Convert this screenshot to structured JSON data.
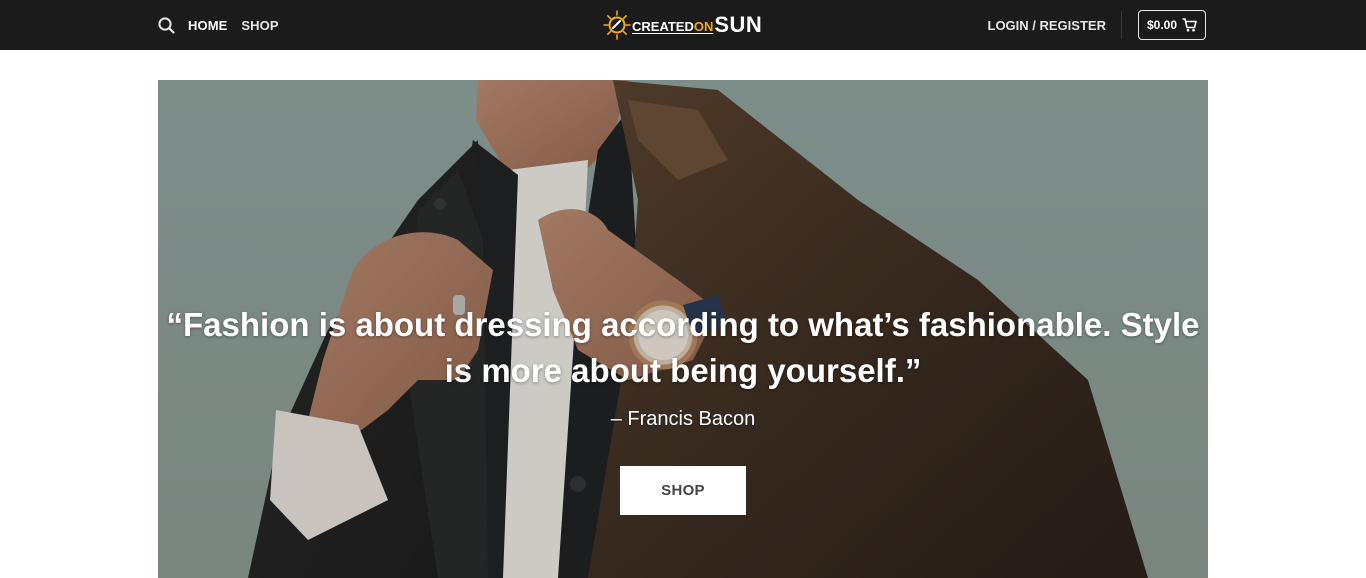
{
  "header": {
    "nav": {
      "search_icon": "search-icon",
      "home_label": "HOME",
      "shop_label": "SHOP"
    },
    "logo": {
      "text_created": "CREATED",
      "text_on": "ON",
      "text_sun": "SUN",
      "brand_color": "#f4a71c"
    },
    "account": {
      "login_label": "LOGIN / REGISTER"
    },
    "cart": {
      "total": "$0.00",
      "icon": "cart-icon"
    }
  },
  "hero": {
    "quote": "“Fashion is about dressing according to what’s fashionable. Style is more about being yourself.”",
    "author": "– Francis Bacon",
    "cta_label": "SHOP"
  },
  "colors": {
    "header_bg": "#1b1b1b",
    "page_bg": "#ffffff",
    "accent": "#f4a71c"
  }
}
